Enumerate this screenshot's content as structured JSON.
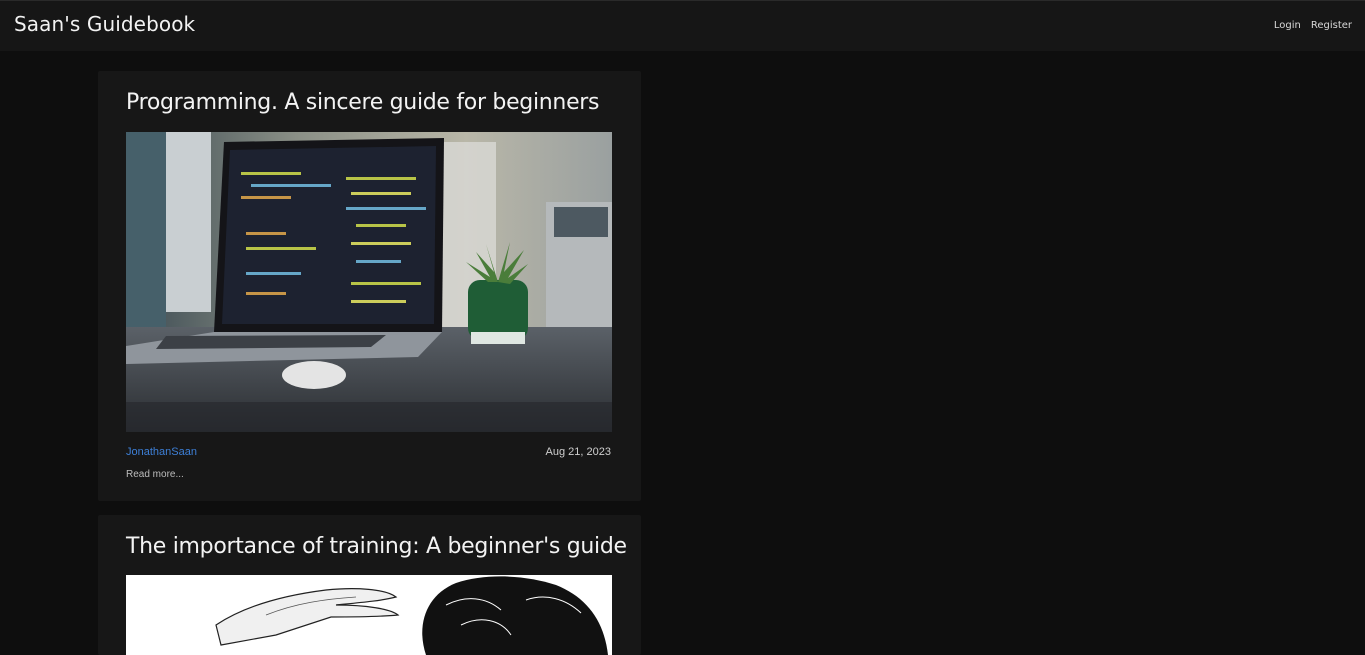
{
  "header": {
    "brand": "Saan's Guidebook",
    "links": [
      "Login",
      "Register"
    ]
  },
  "posts": [
    {
      "title": "Programming. A sincere guide for beginners",
      "image_alt": "Laptop showing code next to a succulent plant",
      "author": "JonathanSaan",
      "date": "Aug 21, 2023",
      "read_more": "Read more..."
    },
    {
      "title": "The importance of training: A beginner's guide",
      "image_alt": "Ink illustration of a hand and a person with dark hair"
    }
  ],
  "colors": {
    "background": "#0e0e0e",
    "navbar": "#161616",
    "card": "#171717",
    "author_link": "#3d7fd6"
  }
}
